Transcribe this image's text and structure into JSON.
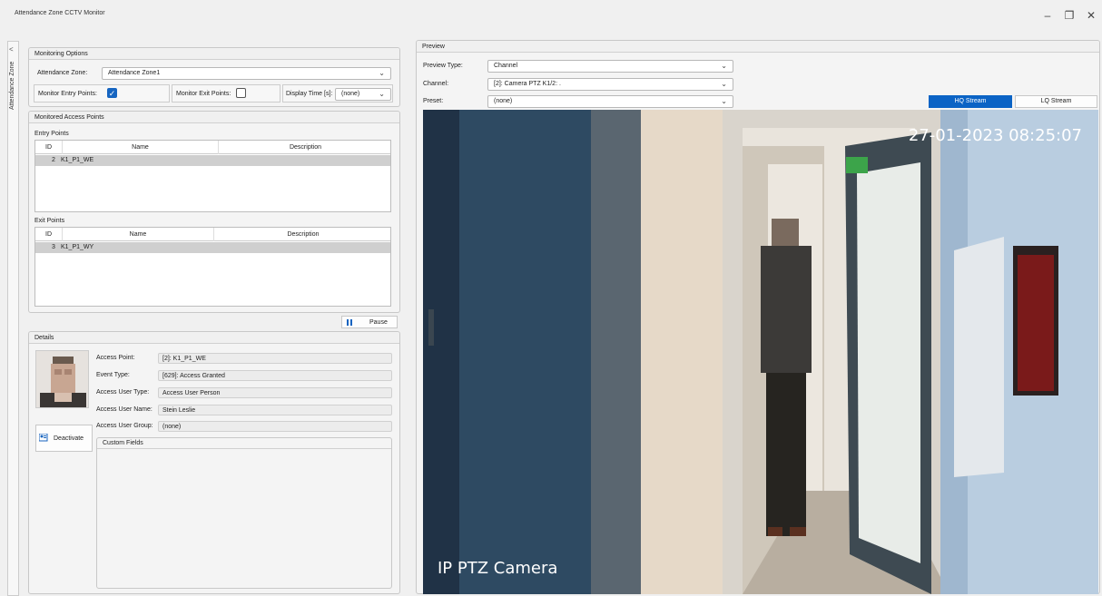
{
  "window": {
    "title": "Attendance Zone CCTV Monitor",
    "minimize": "–",
    "restore": "❐",
    "close": "✕"
  },
  "sidetab": {
    "collapse": "<",
    "label": "Attendance Zone"
  },
  "monitoring_options": {
    "title": "Monitoring Options",
    "zone_label": "Attendance Zone:",
    "zone_value": "Attendance Zone1",
    "entry_label": "Monitor Entry Points:",
    "entry_checked": true,
    "exit_label": "Monitor Exit Points:",
    "exit_checked": false,
    "display_time_label": "Display Time [s]:",
    "display_time_value": "(none)"
  },
  "monitored_access_points": {
    "title": "Monitored Access Points",
    "entry": {
      "label": "Entry Points",
      "columns": [
        "ID",
        "Name",
        "Description"
      ],
      "rows": [
        {
          "id": "2",
          "name": "K1_P1_WE",
          "description": ""
        }
      ]
    },
    "exit": {
      "label": "Exit Points",
      "columns": [
        "ID",
        "Name",
        "Description"
      ],
      "rows": [
        {
          "id": "3",
          "name": "K1_P1_WY",
          "description": ""
        }
      ]
    }
  },
  "pause_button": {
    "icon": "pause-icon",
    "label": "Pause"
  },
  "details": {
    "title": "Details",
    "access_point_label": "Access Point:",
    "access_point_value": "[2]: K1_P1_WE",
    "event_type_label": "Event Type:",
    "event_type_value": "[629]: Access Granted",
    "user_type_label": "Access User Type:",
    "user_type_value": "Access User Person",
    "user_name_label": "Access User Name:",
    "user_name_value": "Stein Leslie",
    "user_group_label": "Access User Group:",
    "user_group_value": "(none)",
    "deactivate_label": "Deactivate",
    "custom_fields_label": "Custom Fields"
  },
  "preview": {
    "title": "Preview",
    "type_label": "Preview Type:",
    "type_value": "Channel",
    "channel_label": "Channel:",
    "channel_value": "[2]: Camera PTZ K1/2: .",
    "preset_label": "Preset:",
    "preset_value": "(none)",
    "hq_label": "HQ Stream",
    "lq_label": "LQ Stream",
    "timestamp": "27-01-2023 08:25:07",
    "camera_name": "IP PTZ Camera"
  },
  "colors": {
    "accent": "#0b63c5",
    "row_selected": "#cfcfcf"
  }
}
